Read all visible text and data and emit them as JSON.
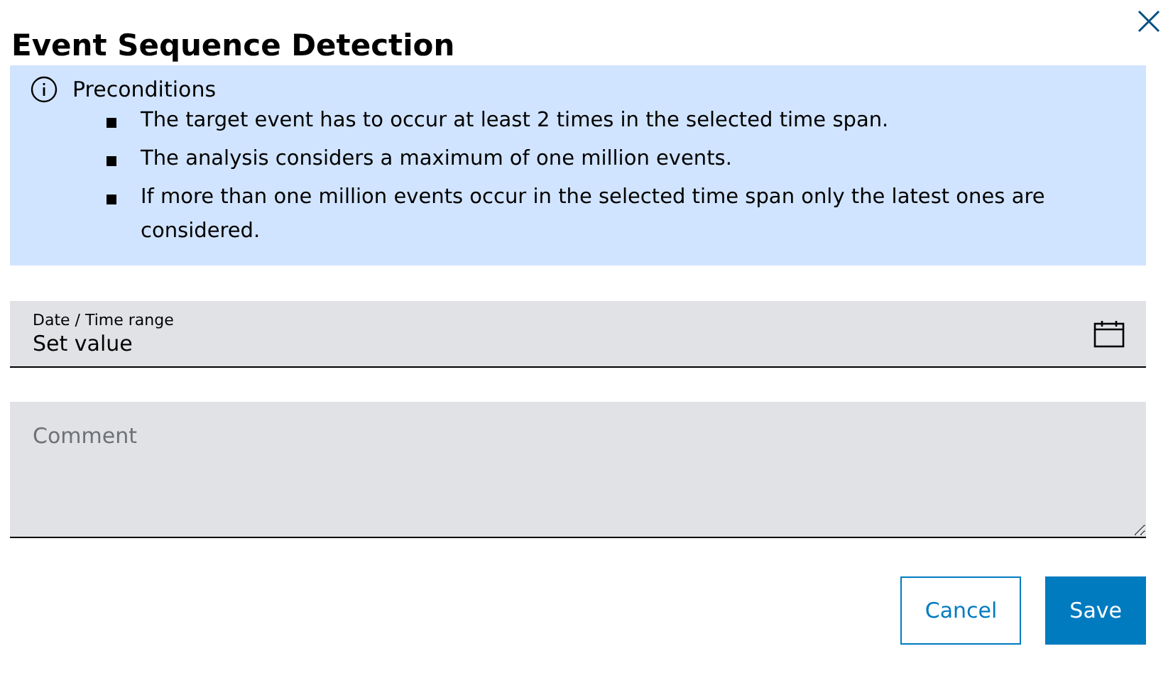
{
  "dialog": {
    "title": "Event Sequence Detection"
  },
  "notice": {
    "heading": "Preconditions",
    "items": [
      "The target event has to occur at least 2 times in the selected time span.",
      "The analysis considers a maximum of one million events.",
      "If more than one million events occur in the selected time span only the latest ones are considered."
    ]
  },
  "date_field": {
    "label": "Date / Time range",
    "value": "Set value"
  },
  "comment_field": {
    "placeholder": "Comment"
  },
  "buttons": [
    {
      "label": "Cancel",
      "kind": "secondary"
    },
    {
      "label": "Save",
      "kind": "primary"
    }
  ]
}
